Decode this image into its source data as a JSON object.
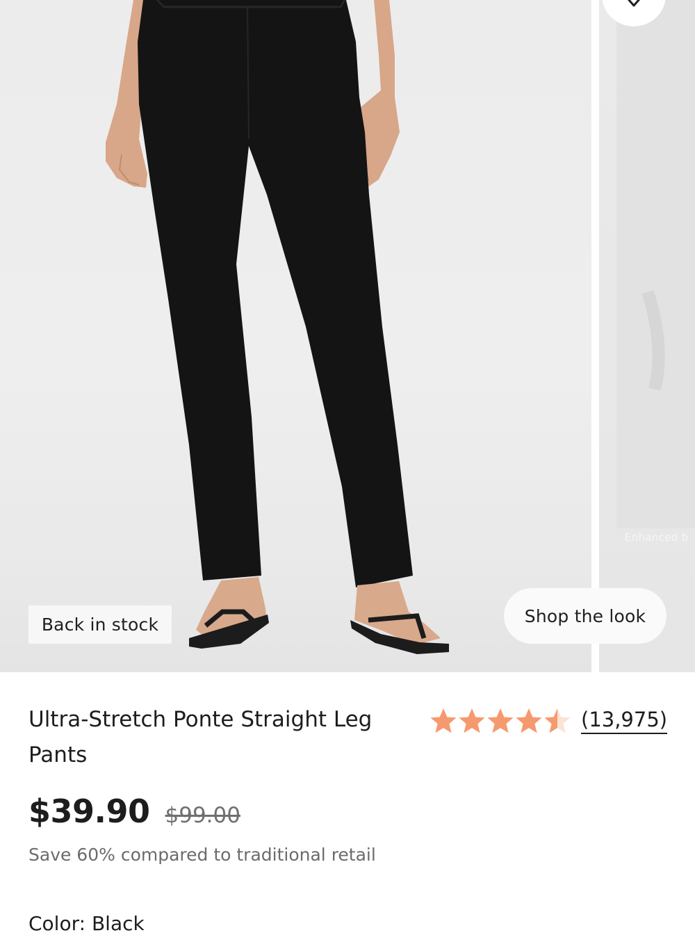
{
  "gallery": {
    "badge": "Back in stock",
    "shop_the_look": "Shop the look",
    "enhanced_label": "Enhanced b"
  },
  "product": {
    "title": "Ultra-Stretch Ponte Straight Leg Pants",
    "rating": {
      "stars": 4.5,
      "max_stars": 5,
      "review_count": "(13,975)",
      "star_color": "#f59a6e"
    },
    "price": "$39.90",
    "original_price": "$99.00",
    "savings_text": "Save 60% compared to traditional retail",
    "color_label": "Color:",
    "color_value": "Black"
  },
  "icons": {
    "wishlist": "heart-icon",
    "star": "star-icon"
  }
}
